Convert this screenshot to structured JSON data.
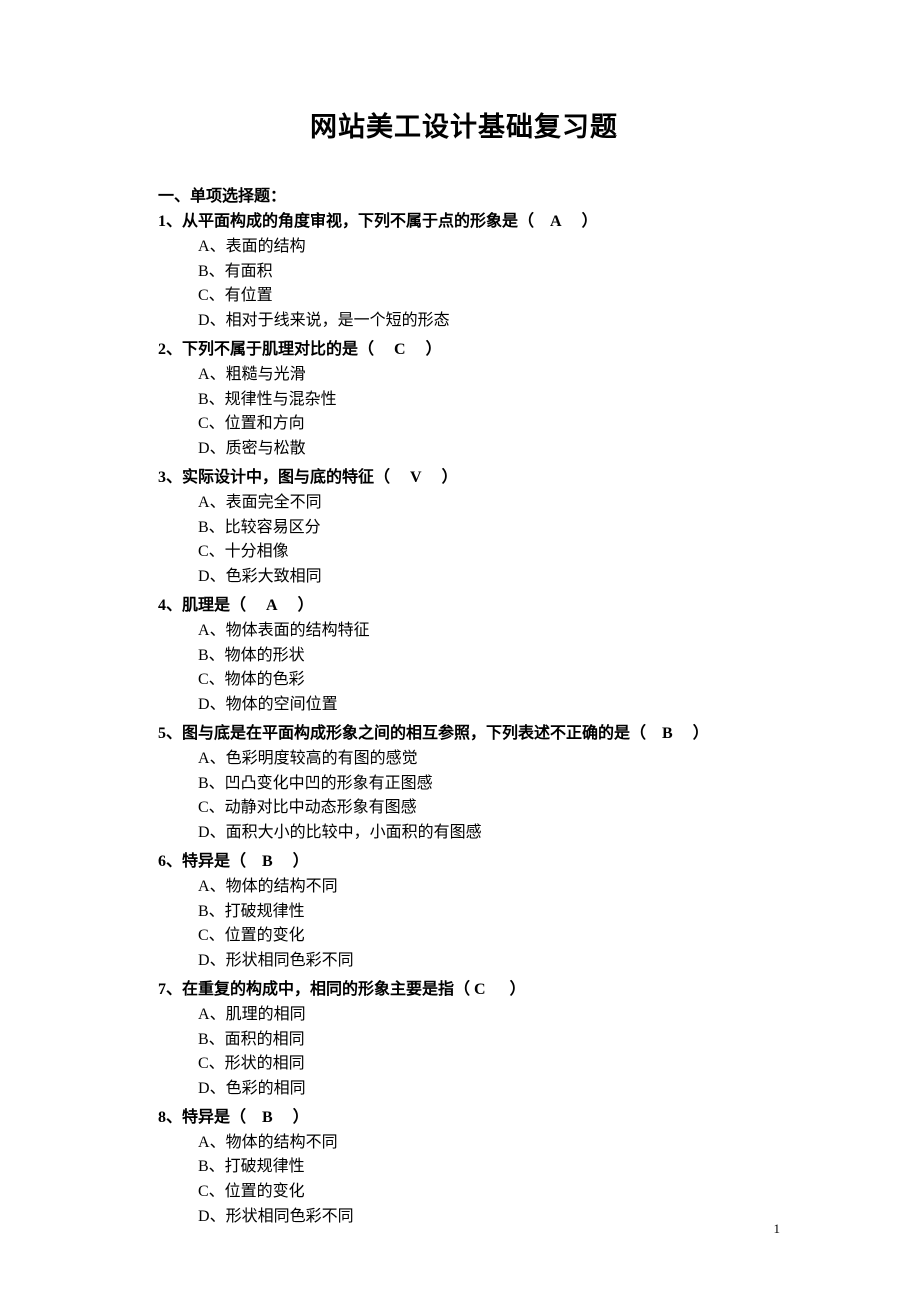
{
  "title": "网站美工设计基础复习题",
  "sectionHeader": "一、单项选择题：",
  "pageNumber": "1",
  "questions": [
    {
      "num": "1",
      "text": "、从平面构成的角度审视，下列不属于点的形象是（　",
      "answer": "A",
      "after": "　  ）",
      "options": [
        {
          "l": "A",
          "t": "、表面的结构"
        },
        {
          "l": "B",
          "t": "、有面积"
        },
        {
          "l": "C",
          "t": "、有位置"
        },
        {
          "l": "D",
          "t": "、相对于线来说，是一个短的形态"
        }
      ]
    },
    {
      "num": "2",
      "text": "、下列不属于肌理对比的是（　 ",
      "answer": "C",
      "after": "　 ）",
      "options": [
        {
          "l": "A",
          "t": "、粗糙与光滑"
        },
        {
          "l": "B",
          "t": "、规律性与混杂性"
        },
        {
          "l": "C",
          "t": "、位置和方向"
        },
        {
          "l": "D",
          "t": "、质密与松散"
        }
      ]
    },
    {
      "num": "3",
      "text": "、实际设计中，图与底的特征（　 ",
      "answer": "V",
      "after": "　 ）",
      "options": [
        {
          "l": "A",
          "t": "、表面完全不同"
        },
        {
          "l": "B",
          "t": "、比较容易区分"
        },
        {
          "l": "C",
          "t": "、十分相像"
        },
        {
          "l": "D",
          "t": "、色彩大致相同"
        }
      ]
    },
    {
      "num": "4",
      "text": "、肌理是（　 ",
      "answer": "A",
      "after": "　 ）",
      "options": [
        {
          "l": "A",
          "t": "、物体表面的结构特征"
        },
        {
          "l": "B",
          "t": "、物体的形状"
        },
        {
          "l": "C",
          "t": "、物体的色彩"
        },
        {
          "l": "D",
          "t": "、物体的空间位置"
        }
      ]
    },
    {
      "num": "5",
      "text": "、图与底是在平面构成形象之间的相互参照，下列表述不正确的是（　",
      "answer": "B",
      "after": "　 ）",
      "options": [
        {
          "l": "A",
          "t": "、色彩明度较高的有图的感觉"
        },
        {
          "l": "B",
          "t": "、凹凸变化中凹的形象有正图感"
        },
        {
          "l": "C",
          "t": "、动静对比中动态形象有图感"
        },
        {
          "l": "D",
          "t": "、面积大小的比较中，小面积的有图感"
        }
      ]
    },
    {
      "num": "6",
      "text": "、特异是（　",
      "answer": "B",
      "after": "　  ）",
      "options": [
        {
          "l": "A",
          "t": "、物体的结构不同"
        },
        {
          "l": "B",
          "t": "、打破规律性"
        },
        {
          "l": "C",
          "t": "、位置的变化"
        },
        {
          "l": "D",
          "t": "、形状相同色彩不同"
        }
      ]
    },
    {
      "num": "7",
      "text": "、在重复的构成中，相同的形象主要是指（ ",
      "answer": "C",
      "after": " 　  ）",
      "options": [
        {
          "l": "A",
          "t": "、肌理的相同"
        },
        {
          "l": "B",
          "t": "、面积的相同"
        },
        {
          "l": "C",
          "t": "、形状的相同"
        },
        {
          "l": "D",
          "t": "、色彩的相同"
        }
      ]
    },
    {
      "num": "8",
      "text": "、特异是（　",
      "answer": "B",
      "after": "　  ）",
      "options": [
        {
          "l": "A",
          "t": "、物体的结构不同"
        },
        {
          "l": "B",
          "t": "、打破规律性"
        },
        {
          "l": "C",
          "t": "、位置的变化"
        },
        {
          "l": "D",
          "t": "、形状相同色彩不同"
        }
      ]
    }
  ]
}
